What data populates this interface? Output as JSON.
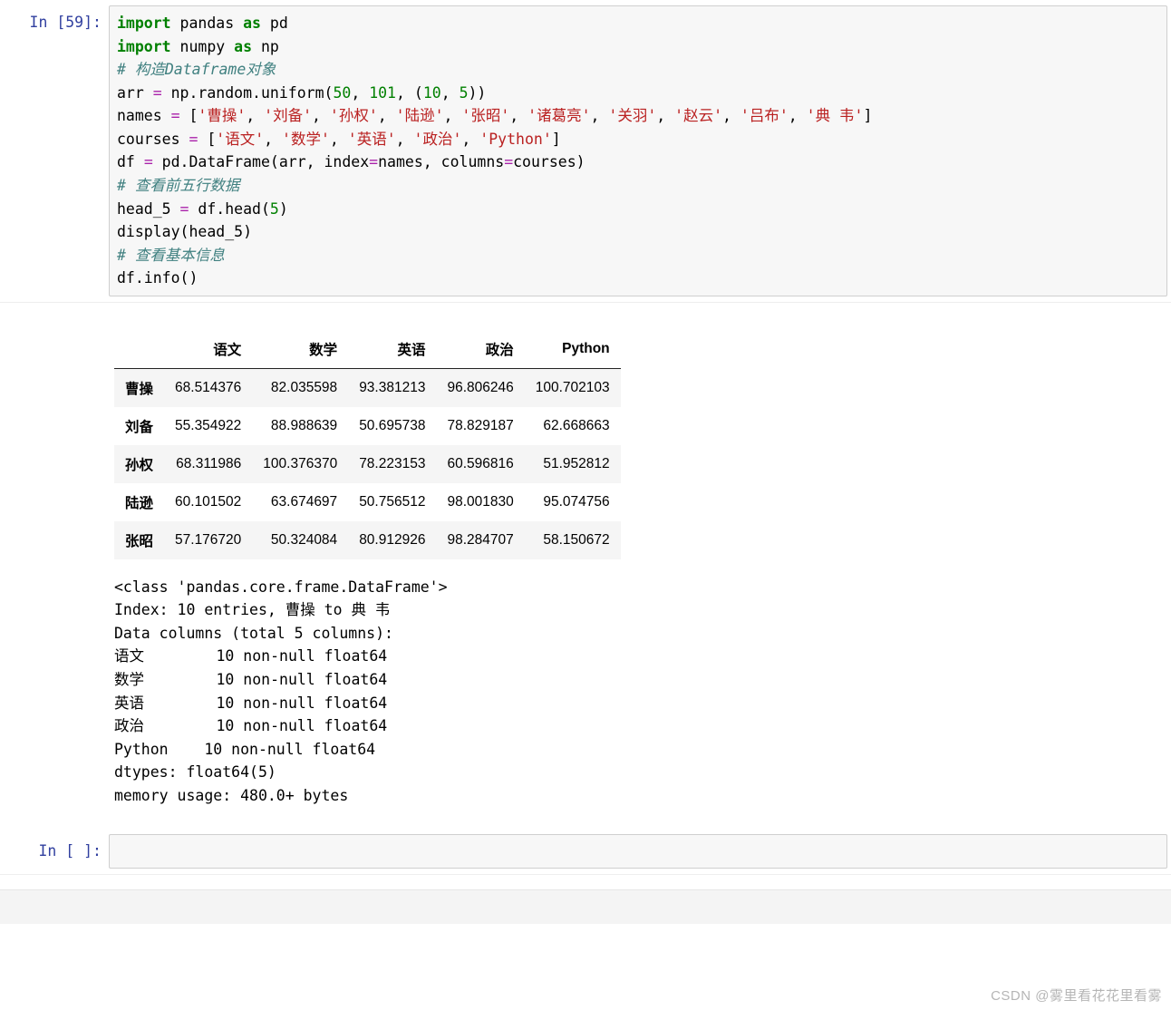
{
  "cell1": {
    "prompt": "In [59]:",
    "code": {
      "l1_import": "import",
      "l1_mod": " pandas ",
      "l1_as": "as",
      "l1_alias": " pd",
      "l2_import": "import",
      "l2_mod": " numpy ",
      "l2_as": "as",
      "l2_alias": " np",
      "l3_comment": "# 构造Dataframe对象",
      "l4_a": "arr ",
      "l4_eq": "=",
      "l4_b": " np.random.uniform(",
      "l4_n1": "50",
      "l4_c": ", ",
      "l4_n2": "101",
      "l4_d": ", (",
      "l4_n3": "10",
      "l4_e": ", ",
      "l4_n4": "5",
      "l4_f": "))",
      "l5_a": "names ",
      "l5_eq": "=",
      "l5_b": " [",
      "l5_s1": "'曹操'",
      "l5_c1": ", ",
      "l5_s2": "'刘备'",
      "l5_c2": ", ",
      "l5_s3": "'孙权'",
      "l5_c3": ", ",
      "l5_s4": "'陆逊'",
      "l5_c4": ", ",
      "l5_s5": "'张昭'",
      "l5_c5": ", ",
      "l5_s6": "'诸葛亮'",
      "l5_c6": ", ",
      "l5_s7": "'关羽'",
      "l5_c7": ", ",
      "l5_s8": "'赵云'",
      "l5_c8": ", ",
      "l5_s9": "'吕布'",
      "l5_c9": ", ",
      "l5_s10": "'典 韦'",
      "l5_end": "]",
      "l6_a": "courses ",
      "l6_eq": "=",
      "l6_b": " [",
      "l6_s1": "'语文'",
      "l6_c1": ", ",
      "l6_s2": "'数学'",
      "l6_c2": ", ",
      "l6_s3": "'英语'",
      "l6_c3": ", ",
      "l6_s4": "'政治'",
      "l6_c4": ", ",
      "l6_s5": "'Python'",
      "l6_end": "]",
      "l7_a": "df ",
      "l7_eq": "=",
      "l7_b": " pd.DataFrame(arr, index",
      "l7_eq2": "=",
      "l7_c": "names, columns",
      "l7_eq3": "=",
      "l7_d": "courses)",
      "l8_comment": "# 查看前五行数据",
      "l9_a": "head_5 ",
      "l9_eq": "=",
      "l9_b": " df.head(",
      "l9_n": "5",
      "l9_c": ")",
      "l10": "display(head_5)",
      "l11_comment": "# 查看基本信息",
      "l12": "df.info()"
    }
  },
  "output": {
    "table": {
      "columns": [
        "语文",
        "数学",
        "英语",
        "政治",
        "Python"
      ],
      "index": [
        "曹操",
        "刘备",
        "孙权",
        "陆逊",
        "张昭"
      ],
      "rows": [
        [
          "68.514376",
          "82.035598",
          "93.381213",
          "96.806246",
          "100.702103"
        ],
        [
          "55.354922",
          "88.988639",
          "50.695738",
          "78.829187",
          "62.668663"
        ],
        [
          "68.311986",
          "100.376370",
          "78.223153",
          "60.596816",
          "51.952812"
        ],
        [
          "60.101502",
          "63.674697",
          "50.756512",
          "98.001830",
          "95.074756"
        ],
        [
          "57.176720",
          "50.324084",
          "80.912926",
          "98.284707",
          "58.150672"
        ]
      ]
    },
    "info": "<class 'pandas.core.frame.DataFrame'>\nIndex: 10 entries, 曹操 to 典 韦\nData columns (total 5 columns):\n语文        10 non-null float64\n数学        10 non-null float64\n英语        10 non-null float64\n政治        10 non-null float64\nPython    10 non-null float64\ndtypes: float64(5)\nmemory usage: 480.0+ bytes"
  },
  "cell2": {
    "prompt": "In [ ]:"
  },
  "watermark": "CSDN @雾里看花花里看雾"
}
